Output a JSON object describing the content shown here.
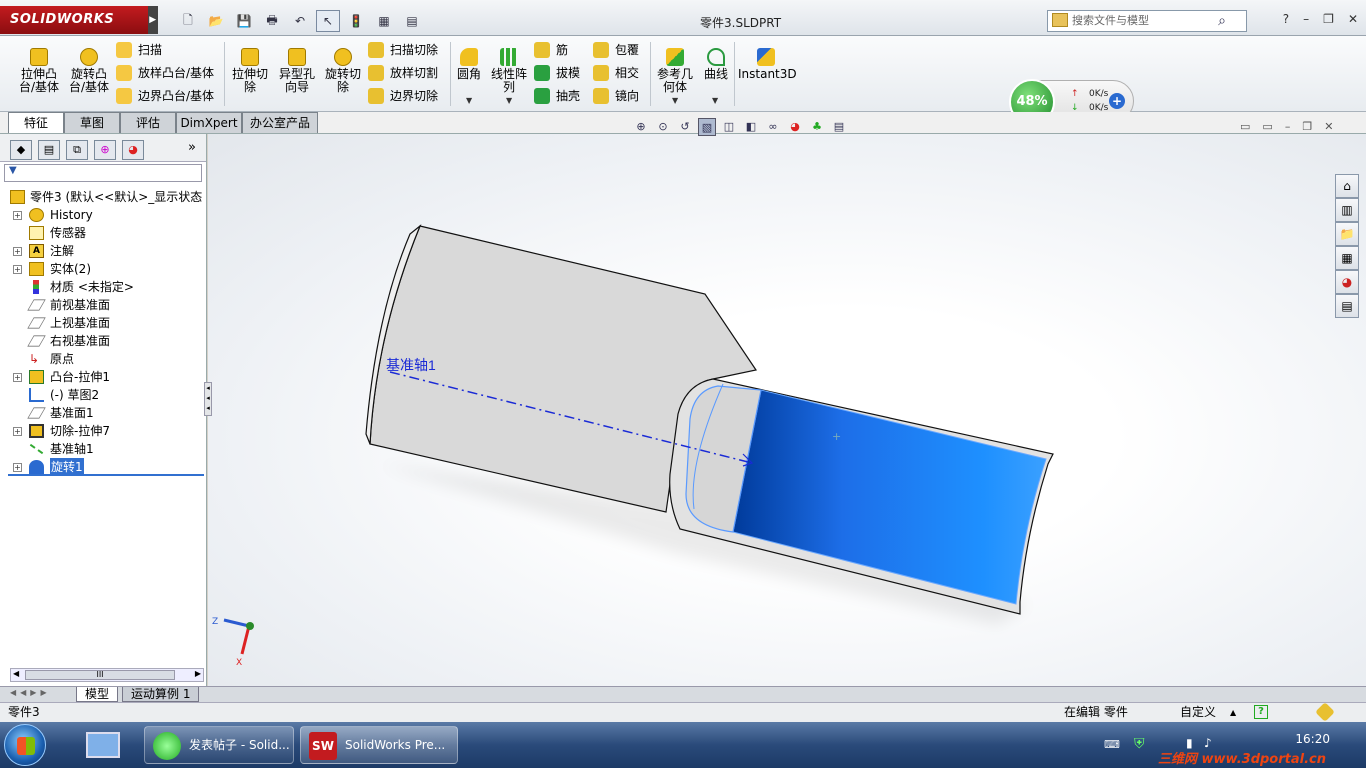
{
  "titlebar": {
    "logo": "SOLIDWORKS",
    "doc_title": "零件3.SLDPRT",
    "search_placeholder": "搜索文件与模型",
    "help": "?",
    "minimize": "–",
    "restore": "❐",
    "close": "✕"
  },
  "ribbon": {
    "extrude_boss": "拉伸凸台/基体",
    "revolve_boss": "旋转凸台/基体",
    "sweep": "扫描",
    "loft_boss": "放样凸台/基体",
    "boundary_boss": "边界凸台/基体",
    "extrude_cut": "拉伸切除",
    "hole_wizard": "异型孔向导",
    "revolve_cut": "旋转切除",
    "sweep_cut": "扫描切除",
    "loft_cut": "放样切割",
    "boundary_cut": "边界切除",
    "fillet": "圆角",
    "linear_pattern": "线性阵列",
    "rib": "筋",
    "draft": "拔模",
    "shell": "抽壳",
    "wrap": "包覆",
    "intersect": "相交",
    "mirror": "镜向",
    "ref_geometry": "参考几何体",
    "curves": "曲线",
    "instant3d": "Instant3D"
  },
  "tabs": [
    "特征",
    "草图",
    "评估",
    "DimXpert",
    "办公室产品"
  ],
  "tree": {
    "root": "零件3 (默认<<默认>_显示状态",
    "items": [
      {
        "label": "History",
        "expandable": true
      },
      {
        "label": "传感器",
        "expandable": false
      },
      {
        "label": "注解",
        "expandable": true
      },
      {
        "label": "实体(2)",
        "expandable": true
      },
      {
        "label": "材质 <未指定>",
        "expandable": false
      },
      {
        "label": "前视基准面",
        "expandable": false
      },
      {
        "label": "上视基准面",
        "expandable": false
      },
      {
        "label": "右视基准面",
        "expandable": false
      },
      {
        "label": "原点",
        "expandable": false
      },
      {
        "label": "凸台-拉伸1",
        "expandable": true
      },
      {
        "label": "(-) 草图2",
        "expandable": false
      },
      {
        "label": "基准面1",
        "expandable": false
      },
      {
        "label": "切除-拉伸7",
        "expandable": true
      },
      {
        "label": "基准轴1",
        "expandable": false
      },
      {
        "label": "旋转1",
        "expandable": true,
        "selected": true
      }
    ],
    "scroll_label": "III"
  },
  "viewport": {
    "axis_label": "基准轴1",
    "triad_z": "Z",
    "triad_x": "X"
  },
  "netwidget": {
    "percent": "48%",
    "up": "0K/s",
    "down": "0K/s"
  },
  "bottom_tabs": [
    "模型",
    "运动算例 1"
  ],
  "status": {
    "left": "零件3",
    "mode": "在编辑 零件",
    "custom": "自定义"
  },
  "taskbar": {
    "btn1": "发表帖子 - Solid...",
    "btn2": "SolidWorks Pre...",
    "clock": "16:20",
    "watermark": "三维网 www.3dportal.cn"
  },
  "colors": {
    "accent_blue": "#1f78e0",
    "brand_red": "#c31b1f",
    "part_gray": "#d9d9d9"
  }
}
